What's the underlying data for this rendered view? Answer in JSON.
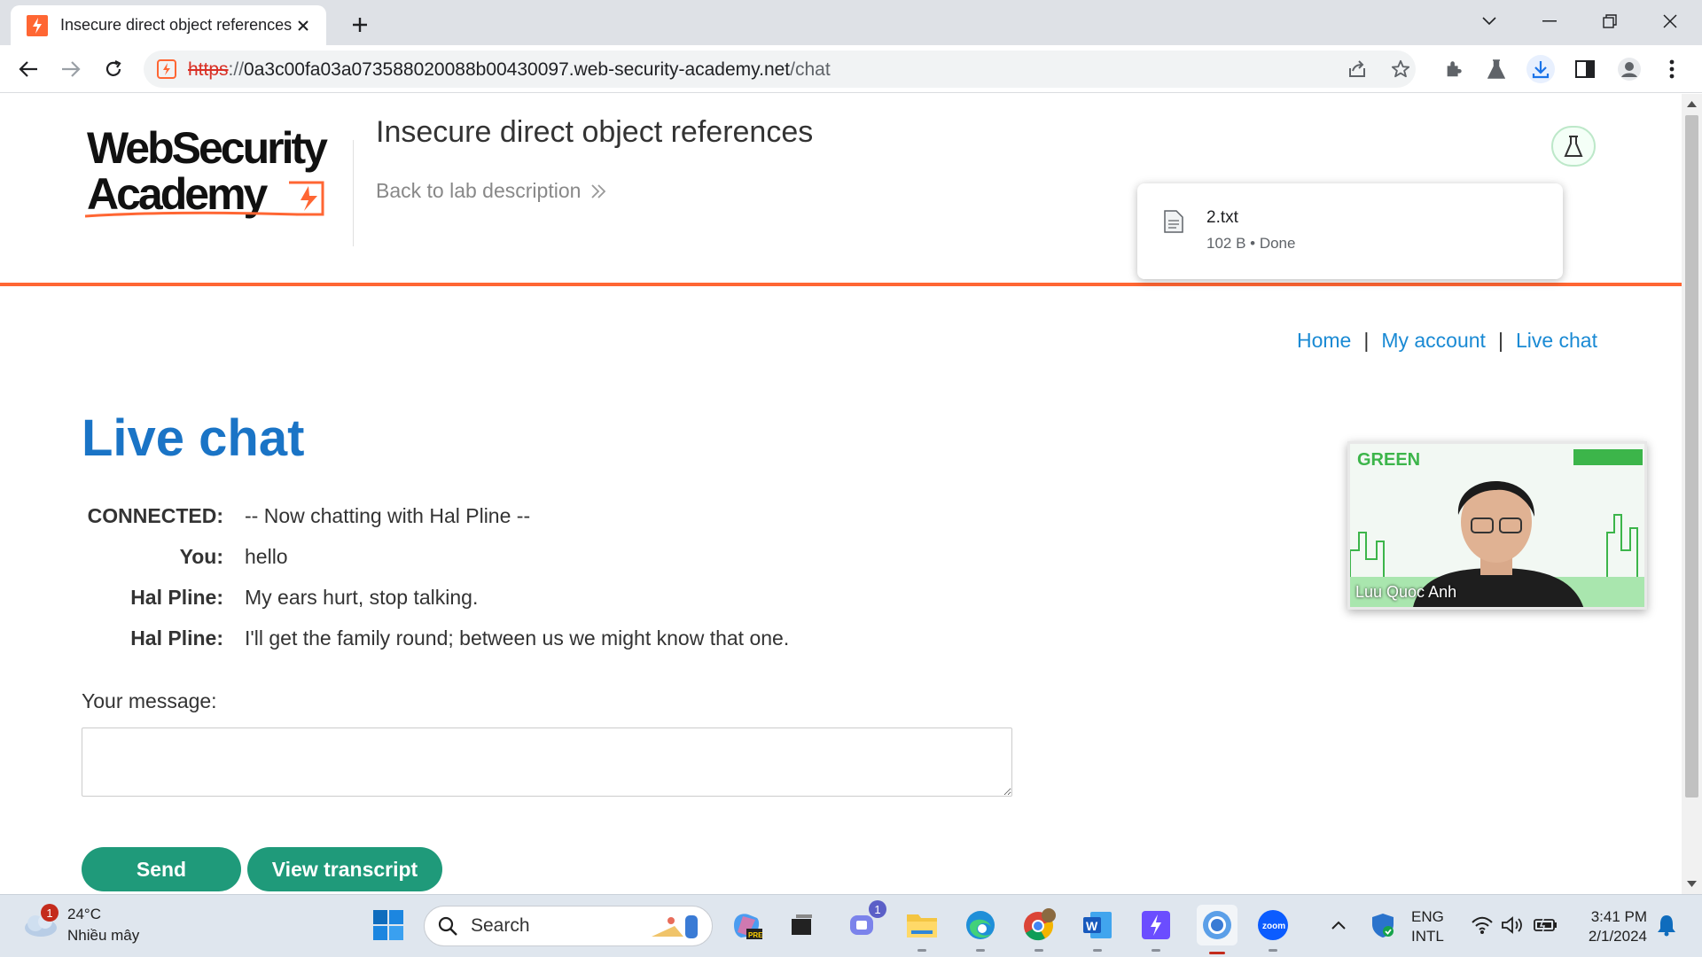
{
  "browser": {
    "tab_title": "Insecure direct object references",
    "url_scheme": "https",
    "url_sep": "://",
    "url_host": "0a3c00fa03a073588020088b00430097.web-security-academy.net",
    "url_path": "/chat"
  },
  "download": {
    "filename": "2.txt",
    "status": "102 B • Done"
  },
  "header": {
    "lab_title": "Insecure direct object references",
    "back_link": "Back to lab description"
  },
  "nav": {
    "home": "Home",
    "separator": "|",
    "my_account": "My account",
    "live_chat": "Live chat"
  },
  "page": {
    "title": "Live chat",
    "messages": [
      {
        "who": "CONNECTED:",
        "text": "-- Now chatting with Hal Pline --"
      },
      {
        "who": "You:",
        "text": "hello"
      },
      {
        "who": "Hal Pline:",
        "text": "My ears hurt, stop talking."
      },
      {
        "who": "Hal Pline:",
        "text": "I'll get the family round; between us we might know that one."
      }
    ],
    "message_label": "Your message:",
    "message_value": "",
    "send_label": "Send",
    "transcript_label": "View transcript"
  },
  "video": {
    "participant": "Luu Quoc Anh"
  },
  "taskbar": {
    "weather_temp": "24°C",
    "weather_cond": "Nhiều mây",
    "weather_badge": "1",
    "search_label": "Search",
    "teams_badge": "1",
    "lang_1": "ENG",
    "lang_2": "INTL",
    "time": "3:41 PM",
    "date": "2/1/2024"
  },
  "colors": {
    "accent_orange": "#ff6633",
    "link_blue": "#1a8ad4",
    "title_blue": "#1a74c6",
    "button_green": "#1f9a7a"
  }
}
